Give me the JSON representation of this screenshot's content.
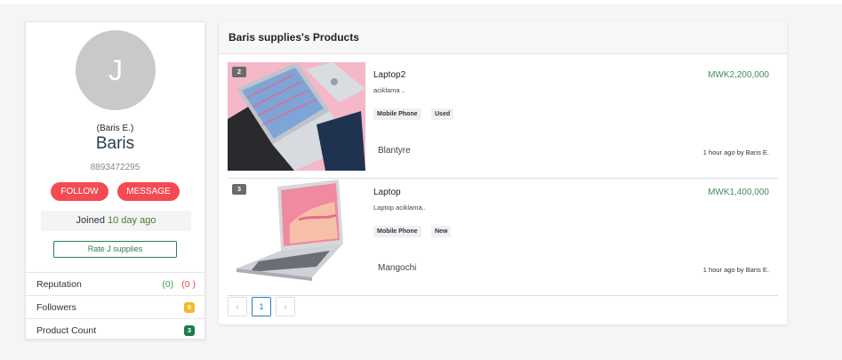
{
  "profile": {
    "avatar_letter": "J",
    "subname": "(Baris E.)",
    "name": "Baris",
    "phone": "8893472295",
    "follow_label": "FOLLOW",
    "message_label": "MESSAGE",
    "joined_label": "Joined",
    "joined_ago": "10 day ago",
    "rate_label": "Rate J supplies",
    "stats": {
      "reputation_label": "Reputation",
      "reputation_positive": "(0)",
      "reputation_negative": "(0 )",
      "followers_label": "Followers",
      "followers_count": "0",
      "product_count_label": "Product Count",
      "product_count": "3"
    }
  },
  "products": {
    "header": "Baris supplies's Products",
    "items": [
      {
        "number": "2",
        "title": "Laptop2",
        "description": "aciklama ..",
        "price": "MWK2,200,000",
        "tags": [
          "Mobile Phone",
          "Used"
        ],
        "location": "Blantyre",
        "time": "1 hour ago by",
        "seller": "Baris E."
      },
      {
        "number": "3",
        "title": "Laptop",
        "description": "Laptop aciklama..",
        "price": "MWK1,400,000",
        "tags": [
          "Mobile Phone",
          "New"
        ],
        "location": "Mangochi",
        "time": "1 hour ago by",
        "seller": "Baris E."
      }
    ],
    "pagination": {
      "prev": "‹",
      "current": "1",
      "next": "›"
    }
  },
  "colors": {
    "accent_red": "#f44a52",
    "price_green": "#3f8f5a",
    "link_blue": "#2f77c4"
  }
}
